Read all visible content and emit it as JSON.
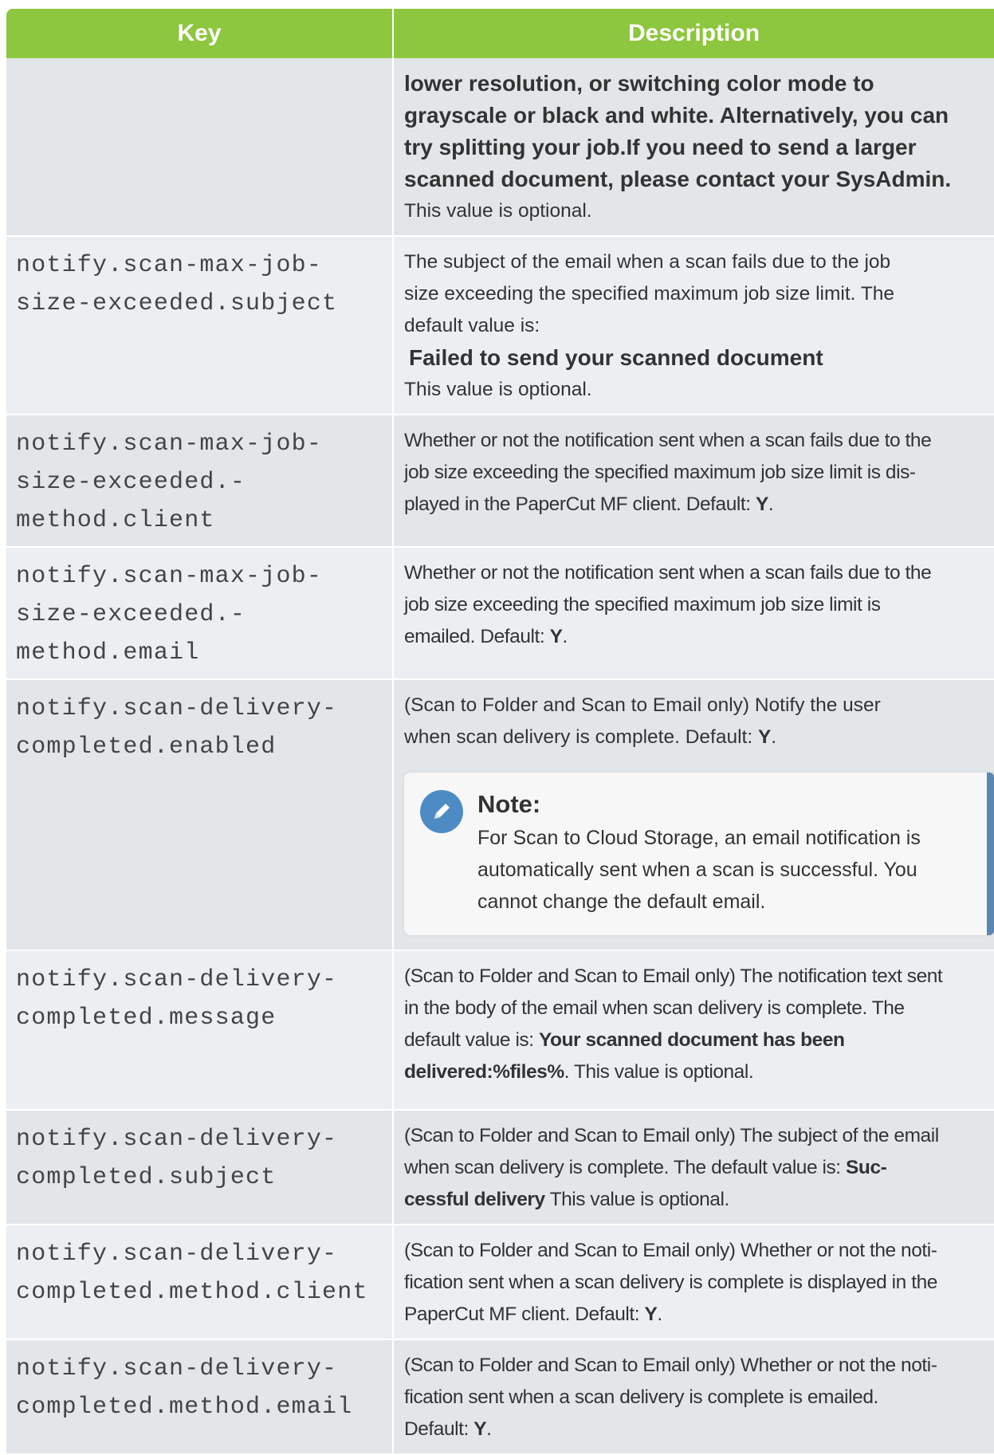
{
  "table": {
    "headers": {
      "key": "Key",
      "description": "Description"
    },
    "row0": {
      "key": [],
      "desc_bold_lines": [
        "lower resolution, or switching color mode to",
        "grayscale or black and white. Alternatively, you can",
        "try splitting your job.If you need to send a larger",
        "scanned document, please contact your SysAdmin."
      ],
      "desc_tail": "This value is optional."
    },
    "row1": {
      "key": [
        "notify.scan-max-job-",
        "size-exceeded.subject"
      ],
      "desc_lines": [
        "The subject of the email when a scan fails due to the job",
        "size exceeding the specified maximum job size limit. The",
        "default value is:"
      ],
      "desc_bold": "Failed to send your scanned document",
      "desc_tail": "This value is optional."
    },
    "row2": {
      "key": [
        "notify.scan-max-job-",
        "size-exceeded.-",
        "method.client"
      ],
      "desc_lines": [
        "Whether or not the notification sent when a scan fails due to the",
        "job size exceeding the specified maximum job size limit is dis-",
        "played in the PaperCut MF client. Default: "
      ],
      "desc_default": "Y"
    },
    "row3": {
      "key": [
        "notify.scan-max-job-",
        "size-exceeded.-",
        "method.email"
      ],
      "desc_lines": [
        "Whether or not the notification sent when a scan fails due to the",
        "job size exceeding the specified maximum job size limit is",
        "emailed. Default: "
      ],
      "desc_default": "Y"
    },
    "row4": {
      "key": [
        "notify.scan-delivery-",
        "completed.enabled"
      ],
      "desc_lines": [
        "(Scan to Folder and Scan to Email only) Notify the user",
        "when scan delivery is complete. Default: "
      ],
      "desc_default": "Y",
      "note": {
        "icon": "pencil-icon",
        "title": "Note:",
        "lines": [
          "For Scan to Cloud Storage, an email notification is",
          "automatically sent when a scan is successful. You",
          "cannot change the default email."
        ]
      }
    },
    "row5": {
      "key": [
        "notify.scan-delivery-",
        "completed.message"
      ],
      "desc_lines": [
        "(Scan to Folder and Scan to Email only) The notification text sent",
        "in the body of the email when scan delivery is complete. The",
        "default value is: "
      ],
      "desc_bold_a": "Your scanned document has been",
      "desc_bold_b": "delivered:%files%",
      "desc_tail": ". This value is optional."
    },
    "row6": {
      "key": [
        "notify.scan-delivery-",
        "completed.subject"
      ],
      "desc_lines": [
        "(Scan to Folder and Scan to Email only) The subject of the email",
        "when scan delivery is complete. The default value is: "
      ],
      "desc_bold_a": "Suc-",
      "desc_bold_b": "cessful delivery",
      "desc_tail": " This value is optional."
    },
    "row7": {
      "key": [
        "notify.scan-delivery-",
        "completed.method.client"
      ],
      "desc_lines": [
        "(Scan to Folder and Scan to Email only) Whether or not the noti-",
        "fication sent when a scan delivery is complete is displayed in the",
        "PaperCut MF client. Default: "
      ],
      "desc_default": "Y"
    },
    "row8": {
      "key": [
        "notify.scan-delivery-",
        "completed.method.email"
      ],
      "desc_lines": [
        "(Scan to Folder and Scan to Email only) Whether or not the noti-",
        "fication sent when a scan delivery is complete is emailed.",
        "Default: "
      ],
      "desc_default": "Y"
    }
  },
  "colors": {
    "header_bg": "#8dc63f",
    "row_bg_a": "#e3e6e8",
    "row_bg_b": "#eceff1",
    "note_accent": "#5b86b2",
    "note_icon_bg": "#4d8bc4"
  }
}
